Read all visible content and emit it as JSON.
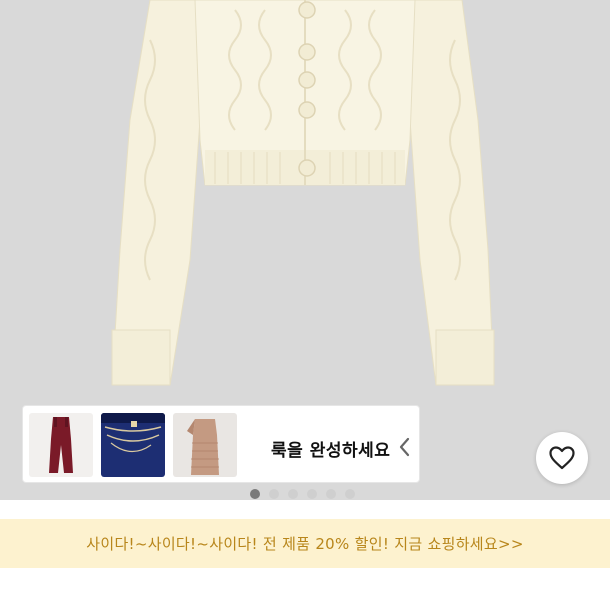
{
  "product": {
    "main_image_icon": "cream-cable-knit-cropped-cardigan",
    "background_color": "#d9d9d9",
    "garment_color": "#f6f1dd"
  },
  "look_carousel": {
    "thumbnails": [
      {
        "icon": "burgundy-jumpsuit-thumb"
      },
      {
        "icon": "navy-velvet-outfit-with-chain-belt-thumb"
      },
      {
        "icon": "beige-knit-dress-thumb"
      }
    ],
    "text": "룩을 완성하세요",
    "chevron_icon": "chevron-left-icon"
  },
  "wishlist": {
    "icon": "heart-outline-icon"
  },
  "pagination": {
    "total": 6,
    "current": 1
  },
  "promo_banner": {
    "text": "사이다!~사이다!~사이다! 전 제품 20% 할인! 지금 쇼핑하세요>>",
    "background": "#fdf2cf",
    "text_color": "#b8861b"
  }
}
